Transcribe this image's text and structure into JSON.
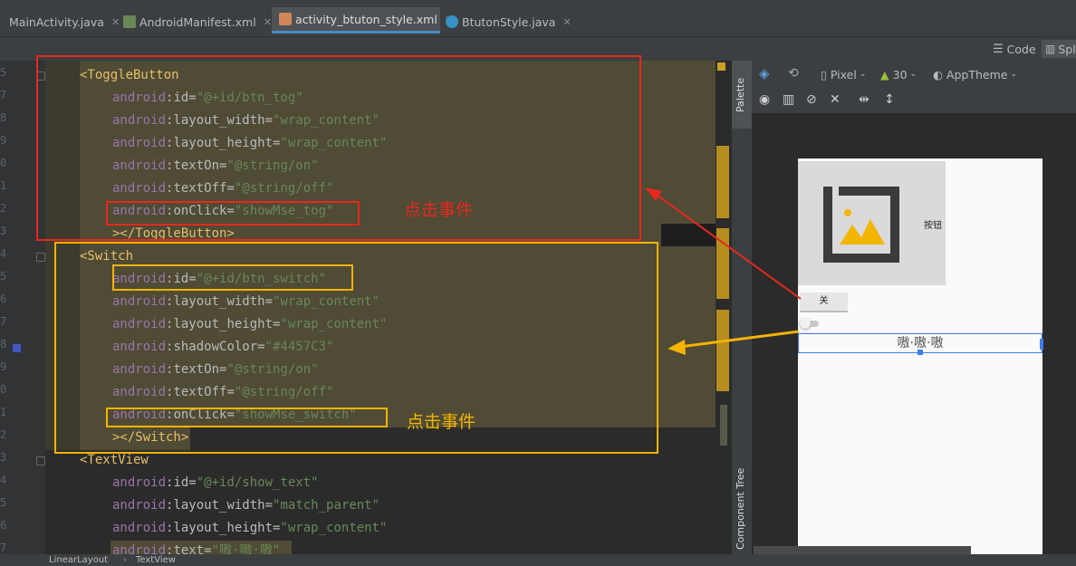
{
  "tabs": [
    {
      "label": "MainActivity.java",
      "icon": "java-class-icon"
    },
    {
      "label": "AndroidManifest.xml",
      "icon": "manifest-icon"
    },
    {
      "label": "activity_btuton_style.xml",
      "icon": "layout-xml-icon"
    },
    {
      "label": "BtutonStyle.java",
      "icon": "java-class-icon"
    }
  ],
  "mode": {
    "code": "Code",
    "split": "Spl"
  },
  "line_numbers": [
    "5",
    "7",
    "8",
    "9",
    "0",
    "1",
    "2",
    "3",
    "4",
    "5",
    "6",
    "7",
    "8",
    "9",
    "0",
    "1",
    "2",
    "3",
    "4",
    "5",
    "6",
    "7"
  ],
  "code": {
    "toggle_open": "<ToggleButton",
    "t_id_name": "android",
    "t_id_attr": ":id=",
    "t_id_val": "\"@+id/btn_tog\"",
    "t_w_name": "android",
    "t_w_attr": ":layout_width=",
    "t_w_val": "\"wrap_content\"",
    "t_h_name": "android",
    "t_h_attr": ":layout_height=",
    "t_h_val": "\"wrap_content\"",
    "t_on_name": "android",
    "t_on_attr": ":textOn=",
    "t_on_val": "\"@string/on\"",
    "t_off_name": "android",
    "t_off_attr": ":textOff=",
    "t_off_val": "\"@string/off\"",
    "t_click_name": "android",
    "t_click_attr": ":onClick=",
    "t_click_val": "\"showMse_tog\"",
    "toggle_close": "></ToggleButton>",
    "switch_open": "<Switch",
    "s_id_name": "android",
    "s_id_attr": ":id=",
    "s_id_val": "\"@+id/btn_switch\"",
    "s_w_name": "android",
    "s_w_attr": ":layout_width=",
    "s_w_val": "\"wrap_content\"",
    "s_h_name": "android",
    "s_h_attr": ":layout_height=",
    "s_h_val": "\"wrap_content\"",
    "s_sh_name": "android",
    "s_sh_attr": ":shadowColor=",
    "s_sh_val": "\"#4457C3\"",
    "s_on_name": "android",
    "s_on_attr": ":textOn=",
    "s_on_val": "\"@string/on\"",
    "s_off_name": "android",
    "s_off_attr": ":textOff=",
    "s_off_val": "\"@string/off\"",
    "s_click_name": "android",
    "s_click_attr": ":onClick=",
    "s_click_val": "\"showMse_switch\"",
    "switch_close": "></Switch>",
    "text_open": "<TextView",
    "v_id_name": "android",
    "v_id_attr": ":id=",
    "v_id_val": "\"@+id/show_text\"",
    "v_w_name": "android",
    "v_w_attr": ":layout_width=",
    "v_w_val": "\"match_parent\"",
    "v_h_name": "android",
    "v_h_attr": ":layout_height=",
    "v_h_val": "\"wrap_content\"",
    "v_t_name": "android",
    "v_t_attr": ":text=",
    "v_t_val": "\"嗷·嗷·嗷\""
  },
  "annotations": {
    "toggle_note": "点击事件",
    "switch_note": "点击事件"
  },
  "palette": {
    "label": "Palette",
    "component_tree": "Component Tree"
  },
  "design_toolbar": {
    "device": "Pixel",
    "api": "30",
    "theme": "AppTheme"
  },
  "preview": {
    "button_label": "按钮",
    "toggle_text": "关",
    "text_view": "嗷·嗷·嗷"
  },
  "breadcrumb": [
    "LinearLayout",
    "TextView"
  ],
  "colors": {
    "red_box": "#e8281d",
    "yellow_box": "#f5b400",
    "shadow_color": "#4457C3"
  }
}
